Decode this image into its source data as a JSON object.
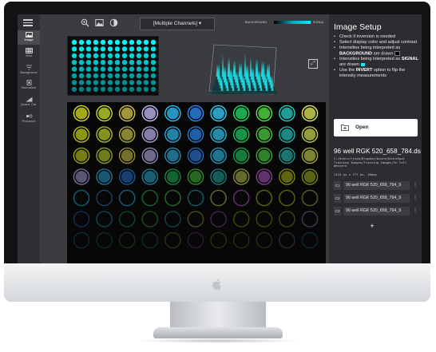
{
  "sidebar": {
    "items": [
      {
        "label": "Image",
        "icon": "image-icon",
        "active": true
      },
      {
        "label": "Grid",
        "icon": "grid-icon",
        "active": false
      },
      {
        "label": "Background",
        "icon": "background-icon",
        "active": false
      },
      {
        "label": "Normalize",
        "icon": "normalize-icon",
        "active": false
      },
      {
        "label": "Quant. Cal.",
        "icon": "quant-cal-icon",
        "active": false
      },
      {
        "label": "Presence",
        "icon": "presence-icon",
        "active": false
      }
    ]
  },
  "toolbar": {
    "tools": [
      "zoom-icon",
      "image-adjust-icon",
      "contrast-icon"
    ],
    "channel_select": "[Multiple Channels] ▾",
    "gradient_left_label": "BACKGROUND",
    "gradient_right_label": "SIGNAL",
    "gradient_colors": [
      "#000000",
      "#0aa6b8",
      "#00f0ff"
    ]
  },
  "panel": {
    "title": "Image Setup",
    "instructions": [
      {
        "pre": "Check if inversion is needed",
        "bold": "",
        "post": "",
        "swatch": ""
      },
      {
        "pre": "Select display color and adjust contrast",
        "bold": "",
        "post": "",
        "swatch": ""
      },
      {
        "pre": "Intensities being interpreted as ",
        "bold": "BACKGROUND",
        "post": " are drawn",
        "swatch": "#000000"
      },
      {
        "pre": "Intensities being interpreted as ",
        "bold": "SIGNAL",
        "post": " are drawn",
        "swatch": "#18e6f0"
      },
      {
        "pre": "Use the ",
        "bold": "INVERT",
        "post": " option to flip the intensity measurements",
        "swatch": ""
      }
    ],
    "open_label": "Open",
    "file_name": "96 well RGK 520_658_784.ds",
    "file_path": "C:/Users/rjuyb/Dropbox/Azure/AzureSpot Training Images/Training Images/In Cell Western",
    "file_meta": "1113 px x 777 px, 16bpp",
    "channels": [
      {
        "badge": "C1",
        "name": "96 well RGK 520_658_784_9"
      },
      {
        "badge": "C2",
        "name": "96 well RGK 520_658_784_9"
      },
      {
        "badge": "C3",
        "name": "96 well RGK 520_658_784_9"
      }
    ],
    "add_label": "+"
  },
  "accent": "#18e6f0"
}
